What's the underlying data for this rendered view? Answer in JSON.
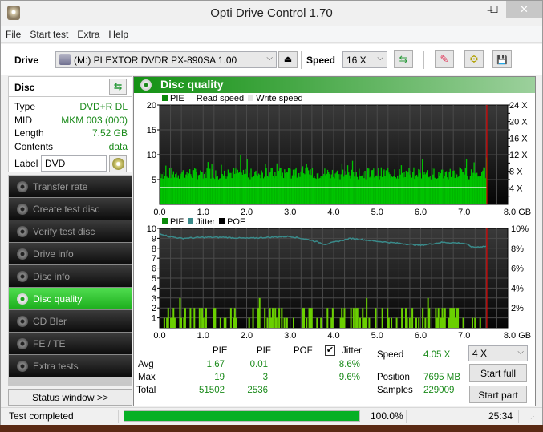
{
  "window": {
    "title": "Opti Drive Control 1.70",
    "minimize": "‒",
    "maximize": "☐",
    "close": "✕"
  },
  "menu": [
    "File",
    "Start test",
    "Extra",
    "Help"
  ],
  "toolbar": {
    "drive_label": "Drive",
    "drive_value": "(M:)  PLEXTOR DVDR   PX-890SA 1.00",
    "speed_label": "Speed",
    "speed_value": "16 X",
    "eject_glyph": "⏏",
    "refresh_glyph": "⇆",
    "erase_glyph": "✎",
    "config_glyph": "⚙",
    "save_glyph": "💾"
  },
  "disc": {
    "header": "Disc",
    "rows": [
      {
        "label": "Type",
        "value": "DVD+R DL"
      },
      {
        "label": "MID",
        "value": "MKM 003 (000)"
      },
      {
        "label": "Length",
        "value": "7.52 GB"
      },
      {
        "label": "Contents",
        "value": "data"
      }
    ],
    "label_caption": "Label",
    "label_value": "DVD"
  },
  "nav": [
    {
      "label": "Transfer rate",
      "active": false
    },
    {
      "label": "Create test disc",
      "active": false
    },
    {
      "label": "Verify test disc",
      "active": false
    },
    {
      "label": "Drive info",
      "active": false
    },
    {
      "label": "Disc info",
      "active": false
    },
    {
      "label": "Disc quality",
      "active": true
    },
    {
      "label": "CD Bler",
      "active": false
    },
    {
      "label": "FE / TE",
      "active": false
    },
    {
      "label": "Extra tests",
      "active": false
    }
  ],
  "status_window_button": "Status window >>",
  "panel": {
    "title": "Disc quality"
  },
  "colors": {
    "pie": "#00c400",
    "pif": "#6ad000",
    "jitter": "#3a8a8a",
    "progress": "#06b025",
    "marker": "#e00000",
    "value_text": "#1a8a1a"
  },
  "chart_data": [
    {
      "type": "bar",
      "title": "PIE",
      "legend": [
        "PIE",
        "Read speed",
        "Write speed"
      ],
      "xlabel": "GB",
      "x_ticks": [
        "0.0",
        "1.0",
        "2.0",
        "3.0",
        "4.0",
        "5.0",
        "6.0",
        "7.0",
        "8.0 GB"
      ],
      "xlim": [
        0,
        8
      ],
      "y_ticks": [
        "20",
        "15",
        "10",
        "5"
      ],
      "ylim": [
        0,
        20
      ],
      "y2_ticks": [
        "24 X",
        "20 X",
        "16 X",
        "12 X",
        "8 X",
        "4 X"
      ],
      "y2lim": [
        0,
        24
      ],
      "end_marker_gb": 7.52,
      "read_speed_x": 4.05,
      "pie_avg": 1.67,
      "pie_max": 19,
      "series_profile_gb": [
        0.0,
        0.05,
        0.1,
        0.2,
        0.3,
        0.6,
        0.7,
        1.0,
        1.2,
        1.5,
        2.0,
        2.5,
        2.9,
        3.0,
        3.5,
        3.8,
        4.0,
        4.5,
        5.0,
        5.5,
        6.0,
        6.5,
        7.0,
        7.1,
        7.3,
        7.5
      ],
      "series_peak_pie": [
        11,
        19,
        10,
        12,
        10,
        13,
        10,
        9,
        11,
        8,
        11,
        9,
        8,
        11,
        8,
        7,
        8,
        9,
        8,
        8,
        10,
        9,
        8,
        13,
        7,
        10
      ]
    },
    {
      "type": "bar",
      "title": "PIF / Jitter",
      "legend": [
        "PIF",
        "Jitter",
        "POF"
      ],
      "xlabel": "GB",
      "x_ticks": [
        "0.0",
        "1.0",
        "2.0",
        "3.0",
        "4.0",
        "5.0",
        "6.0",
        "7.0",
        "8.0 GB"
      ],
      "xlim": [
        0,
        8
      ],
      "y_ticks": [
        "10",
        "9",
        "8",
        "7",
        "6",
        "5",
        "4",
        "3",
        "2",
        "1"
      ],
      "ylim": [
        0,
        10
      ],
      "y2_ticks": [
        "10%",
        "8%",
        "6%",
        "4%",
        "2%"
      ],
      "y2lim": [
        0,
        10
      ],
      "end_marker_gb": 7.52,
      "jitter_gb": [
        0.0,
        0.2,
        0.5,
        1.0,
        1.5,
        2.0,
        2.5,
        3.0,
        3.5,
        3.8,
        4.0,
        4.4,
        5.0,
        5.5,
        6.0,
        6.5,
        7.0,
        7.2,
        7.5
      ],
      "jitter_pct": [
        9.5,
        9.2,
        9.0,
        9.1,
        9.1,
        9.0,
        9.1,
        9.2,
        8.8,
        8.4,
        8.6,
        9.0,
        8.7,
        8.5,
        8.3,
        8.6,
        8.5,
        8.1,
        8.2
      ],
      "pif_max": 3,
      "pif_avg": 0.01
    }
  ],
  "stats": {
    "headers": {
      "pie": "PIE",
      "pif": "PIF",
      "pof": "POF",
      "jitter": "Jitter"
    },
    "jitter_checked": true,
    "rows": [
      {
        "label": "Avg",
        "pie": "1.67",
        "pif": "0.01",
        "jitter": "8.6%"
      },
      {
        "label": "Max",
        "pie": "19",
        "pif": "3",
        "jitter": "9.6%"
      },
      {
        "label": "Total",
        "pie": "51502",
        "pif": "2536",
        "jitter": ""
      }
    ],
    "speed_label": "Speed",
    "speed_value": "4.05 X",
    "position_label": "Position",
    "position_value": "7695 MB",
    "samples_label": "Samples",
    "samples_value": "229009",
    "read_speed_select": "4 X",
    "start_full": "Start full",
    "start_part": "Start part"
  },
  "statusbar": {
    "status": "Test completed",
    "progress": 100.0,
    "progress_text": "100.0%",
    "elapsed": "25:34"
  }
}
